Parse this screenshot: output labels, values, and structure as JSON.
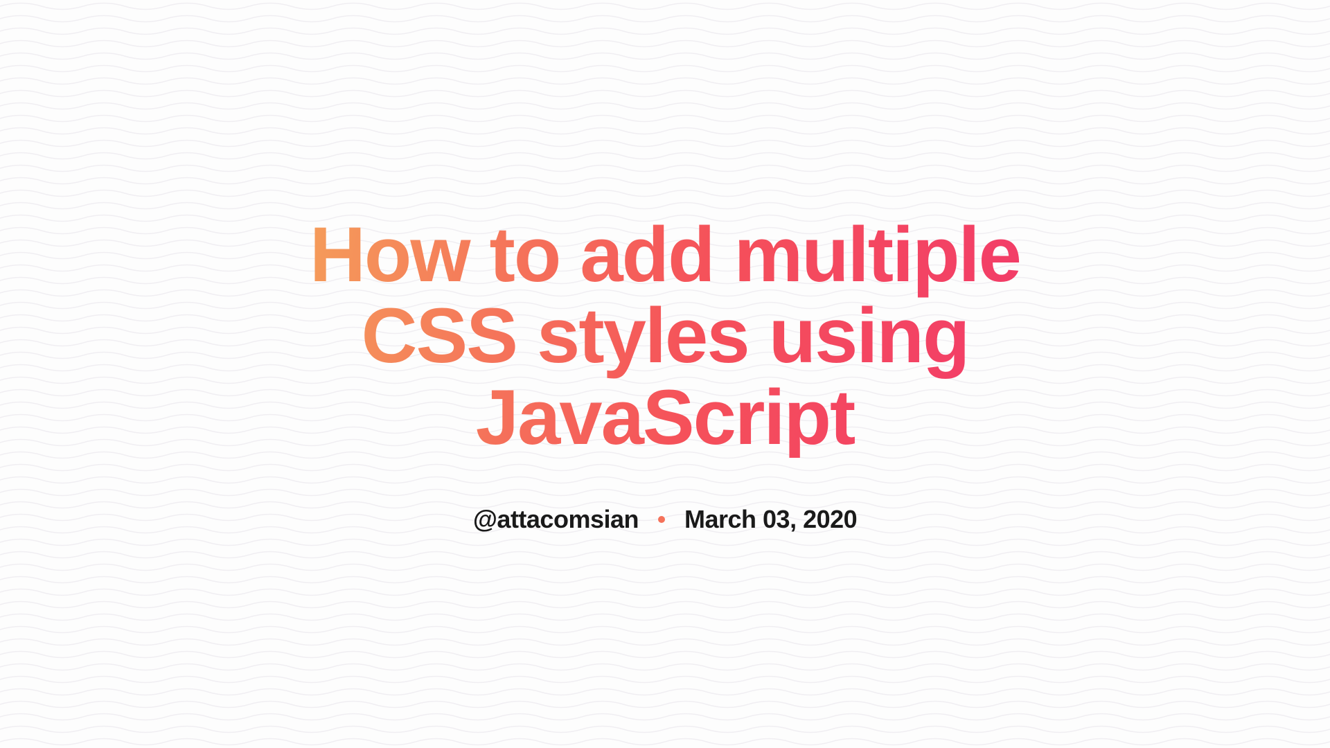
{
  "title": "How to add multiple CSS styles using JavaScript",
  "author": "@attacomsian",
  "date": "March 03, 2020",
  "colors": {
    "gradient_start": "#f5a05a",
    "gradient_end": "#f23a6a",
    "separator": "#f5725a",
    "text": "#1a1a1a",
    "background": "#fdfdfd",
    "wave": "#f0eef2"
  }
}
